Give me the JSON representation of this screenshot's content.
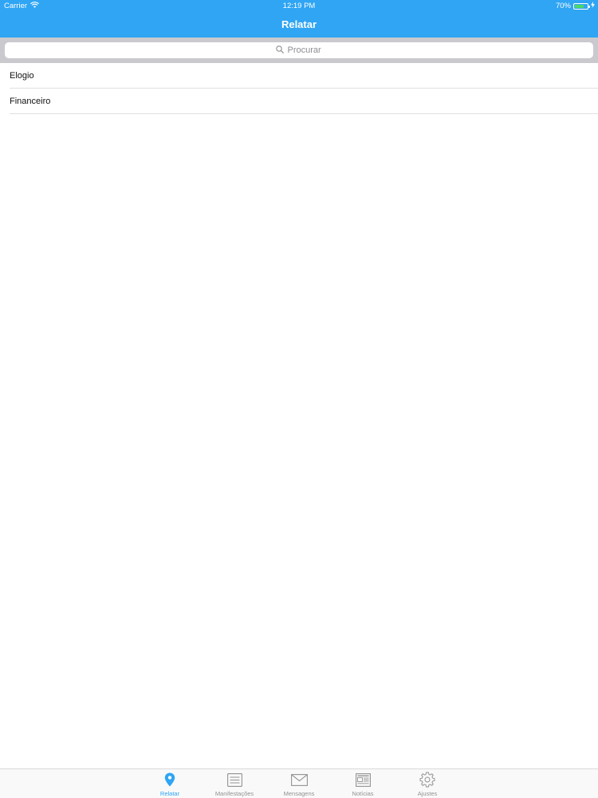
{
  "status_bar": {
    "carrier": "Carrier",
    "time": "12:19 PM",
    "battery": "70%",
    "battery_level": 0.7
  },
  "nav": {
    "title": "Relatar"
  },
  "search": {
    "placeholder": "Procurar"
  },
  "list": {
    "items": [
      {
        "label": "Elogio"
      },
      {
        "label": "Financeiro"
      }
    ]
  },
  "tabs": [
    {
      "label": "Relatar",
      "icon": "location-pin-icon",
      "active": true
    },
    {
      "label": "Manifestações",
      "icon": "list-icon",
      "active": false
    },
    {
      "label": "Mensagens",
      "icon": "envelope-icon",
      "active": false
    },
    {
      "label": "Notícias",
      "icon": "newspaper-icon",
      "active": false
    },
    {
      "label": "Ajustes",
      "icon": "gear-icon",
      "active": false
    }
  ],
  "colors": {
    "accent": "#2fa5f4",
    "inactive": "#929292",
    "battery": "#4cd964"
  }
}
